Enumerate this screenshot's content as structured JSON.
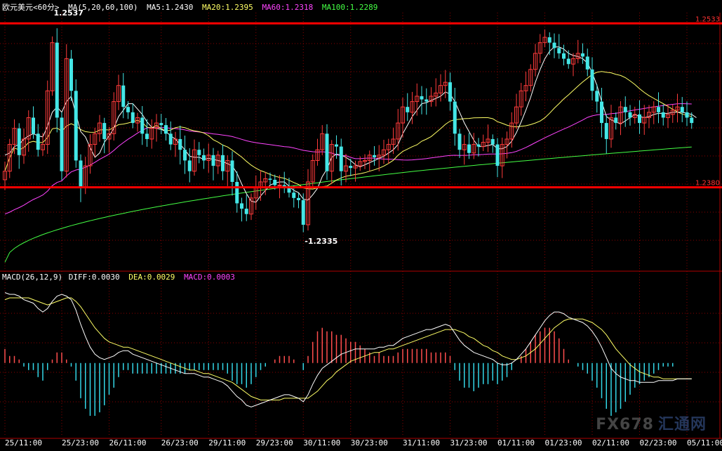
{
  "header": {
    "symbol": "欧元美元<60分>",
    "ma_label": "MA(5,20,60,100)",
    "ma5": "MA5:1.2430",
    "ma20": "MA20:1.2395",
    "ma60": "MA60:1.2318",
    "ma100": "MA100:1.2289"
  },
  "macd_header": {
    "label": "MACD(26,12,9)",
    "diff": "DIFF:0.0030",
    "dea": "DEA:0.0029",
    "macd": "MACD:0.0003"
  },
  "watermark": {
    "latin": "FX678",
    "cn": "汇通网"
  },
  "colors": {
    "up": "#ff3b3b",
    "down": "#44e6e6",
    "ma5": "#ffffff",
    "ma20": "#ffff66",
    "ma60": "#ff44ff",
    "ma100": "#44ff44",
    "resistance": "#ff0000",
    "grid": "#8b0000"
  },
  "chart_data": [
    {
      "type": "candlestick",
      "price_ylim": [
        1.2303,
        1.2543
      ],
      "horizontal_lines": [
        {
          "value": 1.2533,
          "label": "1.2533"
        },
        {
          "value": 1.238,
          "label": "1.2380"
        }
      ],
      "annotations": [
        {
          "text": "1.2537",
          "value": 1.2537,
          "index": 10
        },
        {
          "text": "-1.2335",
          "value": 1.2335,
          "index": 63
        }
      ],
      "x_ticks": [
        {
          "index": 0,
          "label": "25/11:00"
        },
        {
          "index": 12,
          "label": "25/23:00"
        },
        {
          "index": 22,
          "label": "26/11:00"
        },
        {
          "index": 33,
          "label": "26/23:00"
        },
        {
          "index": 43,
          "label": "29/11:00"
        },
        {
          "index": 53,
          "label": "29/23:00"
        },
        {
          "index": 63,
          "label": "30/11:00"
        },
        {
          "index": 73,
          "label": "30/23:00"
        },
        {
          "index": 84,
          "label": "31/11:00"
        },
        {
          "index": 94,
          "label": "31/23:00"
        },
        {
          "index": 104,
          "label": "01/11:00"
        },
        {
          "index": 114,
          "label": "01/23:00"
        },
        {
          "index": 124,
          "label": "02/11:00"
        },
        {
          "index": 134,
          "label": "02/23:00"
        },
        {
          "index": 144,
          "label": "05/11:00"
        }
      ],
      "closes": [
        1.2395,
        1.242,
        1.2435,
        1.241,
        1.2425,
        1.2445,
        1.243,
        1.2415,
        1.242,
        1.247,
        1.2515,
        1.2445,
        1.2395,
        1.25,
        1.247,
        1.2405,
        1.238,
        1.24,
        1.242,
        1.243,
        1.244,
        1.2425,
        1.243,
        1.246,
        1.2475,
        1.2455,
        1.245,
        1.244,
        1.2445,
        1.243,
        1.2425,
        1.2435,
        1.244,
        1.2438,
        1.243,
        1.242,
        1.2425,
        1.2415,
        1.2405,
        1.2395,
        1.2415,
        1.241,
        1.2405,
        1.241,
        1.24,
        1.241,
        1.2395,
        1.2405,
        1.2385,
        1.2365,
        1.236,
        1.2355,
        1.237,
        1.238,
        1.2385,
        1.2388,
        1.2387,
        1.2382,
        1.2382,
        1.238,
        1.2375,
        1.237,
        1.2368,
        1.2345,
        1.2385,
        1.2405,
        1.2415,
        1.243,
        1.2395,
        1.242,
        1.2418,
        1.2395,
        1.24,
        1.2398,
        1.24,
        1.2404,
        1.2405,
        1.241,
        1.2408,
        1.241,
        1.2415,
        1.242,
        1.2425,
        1.244,
        1.2455,
        1.245,
        1.246,
        1.2465,
        1.2462,
        1.246,
        1.2465,
        1.2468,
        1.2475,
        1.2478,
        1.246,
        1.243,
        1.2415,
        1.242,
        1.2412,
        1.242,
        1.2418,
        1.2422,
        1.2425,
        1.242,
        1.24,
        1.242,
        1.2425,
        1.244,
        1.2455,
        1.247,
        1.2475,
        1.249,
        1.2505,
        1.2515,
        1.252,
        1.2515,
        1.251,
        1.2505,
        1.25,
        1.2495,
        1.25,
        1.2505,
        1.2502,
        1.249,
        1.247,
        1.246,
        1.244,
        1.2425,
        1.2445,
        1.244,
        1.2455,
        1.245,
        1.2445,
        1.2448,
        1.244,
        1.2445,
        1.245,
        1.2455,
        1.245,
        1.2445,
        1.2448,
        1.2452,
        1.2455,
        1.245,
        1.2445,
        1.244
      ],
      "ma5": [
        1.241,
        1.2412,
        1.2418,
        1.242,
        1.2425,
        1.2428,
        1.243,
        1.2428,
        1.2427,
        1.2437,
        1.245,
        1.2455,
        1.245,
        1.246,
        1.2465,
        1.2448,
        1.2432,
        1.2427,
        1.2417,
        1.2408,
        1.2412,
        1.2422,
        1.2428,
        1.2435,
        1.2446,
        1.2452,
        1.2458,
        1.2458,
        1.2453,
        1.2448,
        1.2441,
        1.2436,
        1.2435,
        1.2434,
        1.2432,
        1.2428,
        1.2425,
        1.242,
        1.2415,
        1.2409,
        1.2408,
        1.2408,
        1.2406,
        1.2407,
        1.2406,
        1.2405,
        1.2404,
        1.2402,
        1.24,
        1.2393,
        1.2383,
        1.2374,
        1.2367,
        1.2366,
        1.2372,
        1.2377,
        1.2382,
        1.2384,
        1.2385,
        1.2385,
        1.2381,
        1.2377,
        1.2375,
        1.2369,
        1.2368,
        1.2373,
        1.2379,
        1.239,
        1.2397,
        1.2408,
        1.2411,
        1.241,
        1.2408,
        1.2405,
        1.2401,
        1.2399,
        1.2401,
        1.2403,
        1.2405,
        1.2407,
        1.2409,
        1.2412,
        1.2415,
        1.242,
        1.243,
        1.2438,
        1.2446,
        1.2452,
        1.2458,
        1.2459,
        1.2461,
        1.2463,
        1.2465,
        1.2469,
        1.2467,
        1.246,
        1.245,
        1.244,
        1.2432,
        1.2424,
        1.2418,
        1.2418,
        1.2419,
        1.242,
        1.2416,
        1.2416,
        1.2418,
        1.2423,
        1.2431,
        1.2441,
        1.2452,
        1.2464,
        1.2478,
        1.249,
        1.25,
        1.2507,
        1.2511,
        1.2511,
        1.2509,
        1.2505,
        1.2503,
        1.2502,
        1.25,
        1.2496,
        1.2487,
        1.2475,
        1.246,
        1.2446,
        1.2443,
        1.2441,
        1.2439,
        1.2442,
        1.2445,
        1.2448,
        1.2446,
        1.2445,
        1.2446,
        1.2448,
        1.2449,
        1.2449,
        1.2449,
        1.245,
        1.245,
        1.245,
        1.2449,
        1.2448,
        1.2445
      ]
    },
    {
      "type": "macd",
      "ylim": [
        -0.0042,
        0.0045
      ],
      "diff": [
        0.004,
        0.0039,
        0.0039,
        0.0038,
        0.0036,
        0.0035,
        0.0034,
        0.0031,
        0.0029,
        0.0031,
        0.0035,
        0.0038,
        0.0039,
        0.0038,
        0.0036,
        0.003,
        0.0022,
        0.0015,
        0.0009,
        0.0005,
        0.0003,
        0.0002,
        0.0003,
        0.0004,
        0.0006,
        0.0007,
        0.0007,
        0.0005,
        0.0004,
        0.0003,
        0.0002,
        0.0001,
        0.0,
        -0.0001,
        -0.0002,
        -0.0003,
        -0.0004,
        -0.0005,
        -0.0006,
        -0.0006,
        -0.0006,
        -0.0007,
        -0.0008,
        -0.0008,
        -0.0009,
        -0.001,
        -0.0011,
        -0.0013,
        -0.0016,
        -0.0019,
        -0.0021,
        -0.0024,
        -0.0025,
        -0.0024,
        -0.0023,
        -0.0022,
        -0.0021,
        -0.002,
        -0.0019,
        -0.0018,
        -0.0018,
        -0.0019,
        -0.002,
        -0.0022,
        -0.0018,
        -0.0012,
        -0.0007,
        -0.0003,
        -0.0001,
        0.0001,
        0.0003,
        0.0005,
        0.0006,
        0.0007,
        0.0008,
        0.0008,
        0.0008,
        0.0008,
        0.0008,
        0.0009,
        0.0009,
        0.001,
        0.001,
        0.0012,
        0.0014,
        0.0015,
        0.0016,
        0.0017,
        0.0018,
        0.0019,
        0.0019,
        0.002,
        0.0021,
        0.0022,
        0.0021,
        0.0017,
        0.0013,
        0.001,
        0.0008,
        0.0006,
        0.0005,
        0.0004,
        0.0003,
        0.0002,
        0.0,
        -0.0001,
        -0.0001,
        0.0,
        0.0002,
        0.0005,
        0.0008,
        0.0012,
        0.0016,
        0.002,
        0.0024,
        0.0027,
        0.0029,
        0.0029,
        0.0028,
        0.0026,
        0.0025,
        0.0024,
        0.0023,
        0.0021,
        0.0018,
        0.0014,
        0.0009,
        0.0003,
        -0.0003,
        -0.0006,
        -0.0008,
        -0.0009,
        -0.001,
        -0.001,
        -0.0011,
        -0.0011,
        -0.0011,
        -0.0011,
        -0.001,
        -0.001,
        -0.001,
        -0.001,
        -0.0009,
        -0.0009,
        -0.0009,
        -0.0009
      ],
      "dea": [
        0.0036,
        0.0037,
        0.0037,
        0.0037,
        0.0037,
        0.0037,
        0.0036,
        0.0035,
        0.0034,
        0.0033,
        0.0034,
        0.0035,
        0.0036,
        0.0037,
        0.0037,
        0.0035,
        0.0032,
        0.0028,
        0.0024,
        0.002,
        0.0017,
        0.0014,
        0.0012,
        0.0011,
        0.001,
        0.0009,
        0.0009,
        0.0008,
        0.0007,
        0.0006,
        0.0005,
        0.0004,
        0.0003,
        0.0002,
        0.0001,
        0.0,
        -0.0001,
        -0.0002,
        -0.0003,
        -0.0004,
        -0.0004,
        -0.0005,
        -0.0006,
        -0.0006,
        -0.0007,
        -0.0008,
        -0.0009,
        -0.001,
        -0.0011,
        -0.0013,
        -0.0015,
        -0.0017,
        -0.0019,
        -0.002,
        -0.0021,
        -0.0021,
        -0.0021,
        -0.0021,
        -0.0021,
        -0.002,
        -0.002,
        -0.002,
        -0.002,
        -0.002,
        -0.002,
        -0.0018,
        -0.0016,
        -0.0013,
        -0.001,
        -0.0008,
        -0.0005,
        -0.0003,
        -0.0001,
        0.0001,
        0.0002,
        0.0003,
        0.0004,
        0.0005,
        0.0006,
        0.0006,
        0.0007,
        0.0008,
        0.0008,
        0.0009,
        0.001,
        0.0011,
        0.0012,
        0.0013,
        0.0014,
        0.0015,
        0.0016,
        0.0017,
        0.0018,
        0.0019,
        0.0019,
        0.0019,
        0.0018,
        0.0017,
        0.0015,
        0.0014,
        0.0012,
        0.001,
        0.0009,
        0.0007,
        0.0006,
        0.0004,
        0.0003,
        0.0002,
        0.0002,
        0.0003,
        0.0004,
        0.0006,
        0.0008,
        0.0011,
        0.0014,
        0.0017,
        0.002,
        0.0022,
        0.0024,
        0.0025,
        0.0025,
        0.0025,
        0.0025,
        0.0024,
        0.0023,
        0.0021,
        0.0019,
        0.0016,
        0.0012,
        0.0008,
        0.0005,
        0.0002,
        -0.0001,
        -0.0003,
        -0.0005,
        -0.0006,
        -0.0007,
        -0.0008,
        -0.0008,
        -0.0009,
        -0.0009,
        -0.0009,
        -0.0009,
        -0.0009,
        -0.0009,
        -0.0009
      ]
    }
  ]
}
